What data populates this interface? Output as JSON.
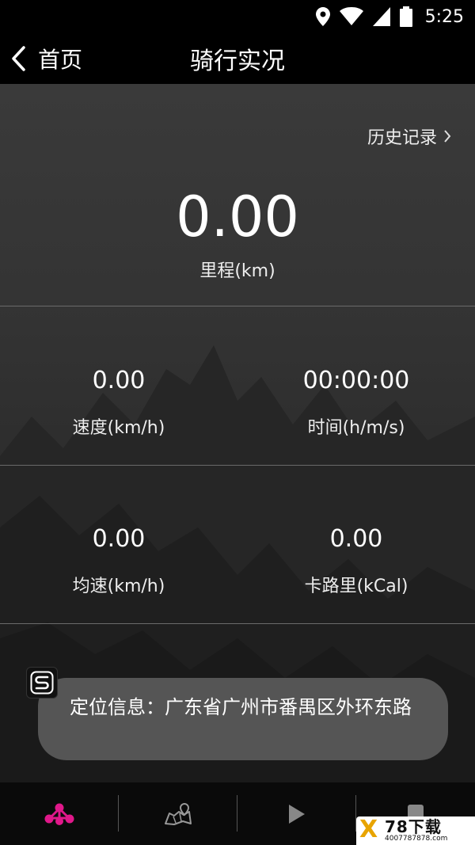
{
  "status_bar": {
    "time": "5:25",
    "icons": [
      "location-icon",
      "wifi-icon",
      "signal-icon",
      "battery-icon"
    ]
  },
  "nav": {
    "back_label": "首页",
    "title": "骑行实况"
  },
  "history_link": "历史记录",
  "distance": {
    "value": "0.00",
    "label": "里程(km)"
  },
  "stats": {
    "speed": {
      "value": "0.00",
      "label": "速度(km/h)"
    },
    "time": {
      "value": "00:00:00",
      "label": "时间(h/m/s)"
    },
    "avg_speed": {
      "value": "0.00",
      "label": "均速(km/h)"
    },
    "calories": {
      "value": "0.00",
      "label": "卡路里(kCal)"
    }
  },
  "toast": {
    "text": "定位信息：广东省广州市番禺区外环东路"
  },
  "bottom_tabs": [
    {
      "icon": "cycling-network-icon",
      "active": true
    },
    {
      "icon": "map-route-icon",
      "active": false
    },
    {
      "icon": "play-icon",
      "active": false
    },
    {
      "icon": "stop-icon",
      "active": false
    }
  ],
  "watermark": {
    "brand": "78下载",
    "url": "4007787878.com"
  },
  "colors": {
    "accent": "#e0188a",
    "background": "#000000",
    "divider": "#6a6a6a",
    "toast": "#555555"
  }
}
